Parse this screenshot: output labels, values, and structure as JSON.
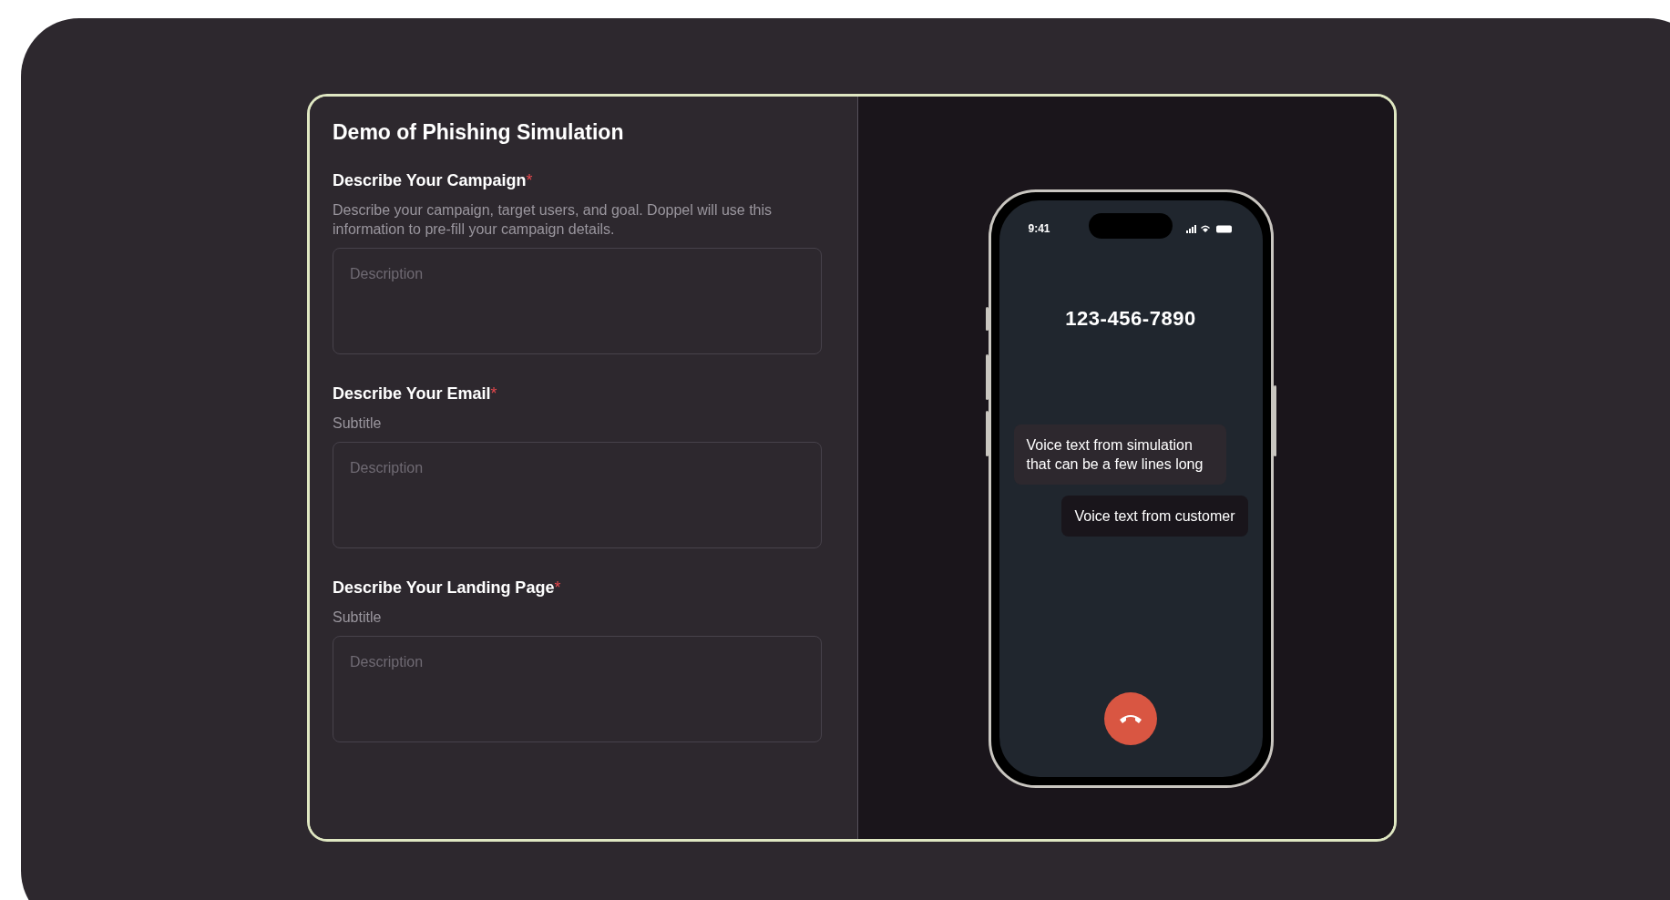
{
  "form": {
    "title": "Demo of Phishing Simulation",
    "sections": [
      {
        "label": "Describe Your Campaign",
        "required_mark": "*",
        "subtitle": "Describe your campaign, target users, and goal. Doppel will use this information to pre-fill your campaign details.",
        "placeholder": "Description"
      },
      {
        "label": "Describe Your Email",
        "required_mark": "*",
        "subtitle": "Subtitle",
        "placeholder": "Description"
      },
      {
        "label": "Describe Your Landing Page",
        "required_mark": "*",
        "subtitle": "Subtitle",
        "placeholder": "Description"
      }
    ]
  },
  "phone": {
    "time": "9:41",
    "caller": "123-456-7890",
    "messages": [
      {
        "kind": "simulation",
        "text": "Voice text from simulation that can be a few lines long"
      },
      {
        "kind": "customer",
        "text": "Voice text from customer"
      }
    ]
  }
}
